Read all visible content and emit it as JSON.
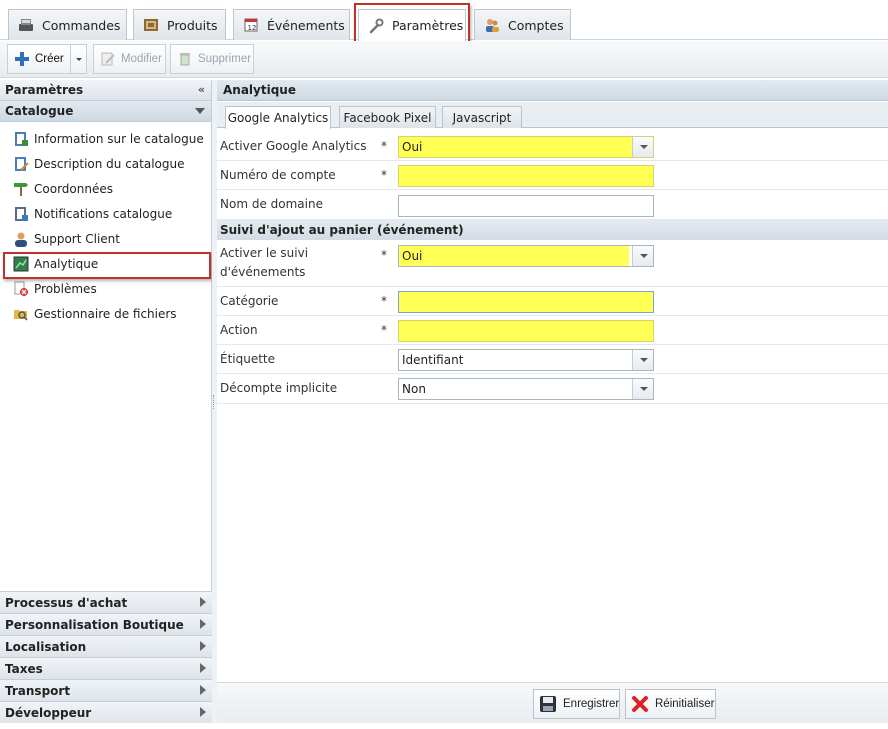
{
  "top_tabs": [
    {
      "label": "Commandes",
      "icon": "register-icon"
    },
    {
      "label": "Produits",
      "icon": "box-icon"
    },
    {
      "label": "Événements",
      "icon": "calendar-icon"
    },
    {
      "label": "Paramètres",
      "icon": "wrench-icon",
      "active": true
    },
    {
      "label": "Comptes",
      "icon": "users-icon"
    }
  ],
  "toolbar": {
    "create_label": "Créer",
    "edit_label": "Modifier",
    "delete_label": "Supprimer"
  },
  "sidebar": {
    "header": "Paramètres",
    "section_title": "Catalogue",
    "items": [
      {
        "label": "Information sur le catalogue"
      },
      {
        "label": "Description du catalogue"
      },
      {
        "label": "Coordonnées"
      },
      {
        "label": "Notifications catalogue"
      },
      {
        "label": "Support Client"
      },
      {
        "label": "Analytique",
        "selected": true
      },
      {
        "label": "Problèmes"
      },
      {
        "label": "Gestionnaire de fichiers"
      }
    ],
    "accordion": [
      {
        "label": "Processus d'achat"
      },
      {
        "label": "Personnalisation Boutique"
      },
      {
        "label": "Localisation"
      },
      {
        "label": "Taxes"
      },
      {
        "label": "Transport"
      },
      {
        "label": "Développeur"
      }
    ]
  },
  "main": {
    "title": "Analytique",
    "tabs": [
      {
        "label": "Google Analytics",
        "active": true
      },
      {
        "label": "Facebook Pixel"
      },
      {
        "label": "Javascript"
      }
    ],
    "fields": [
      {
        "label": "Activer Google Analytics",
        "required": "*",
        "value": "Oui"
      },
      {
        "label": "Numéro de compte",
        "required": "*",
        "value": ""
      },
      {
        "label": "Nom de domaine",
        "required": "",
        "value": ""
      }
    ],
    "section_title": "Suivi d'ajout au panier (événement)",
    "event_fields": [
      {
        "label_line1": "Activer le suivi",
        "label_line2": "d'événements",
        "required": "*",
        "value": "Oui"
      },
      {
        "label": "Catégorie",
        "required": "*",
        "value": ""
      },
      {
        "label": "Action",
        "required": "*",
        "value": ""
      },
      {
        "label": "Étiquette",
        "required": "",
        "value": "Identifiant"
      },
      {
        "label": "Décompte implicite",
        "required": "",
        "value": "Non"
      }
    ],
    "save_label": "Enregistrer",
    "reset_label": "Réinitialiser"
  },
  "colors": {
    "highlight_yellow": "#ffff55",
    "annotation_red": "#c0312b"
  }
}
